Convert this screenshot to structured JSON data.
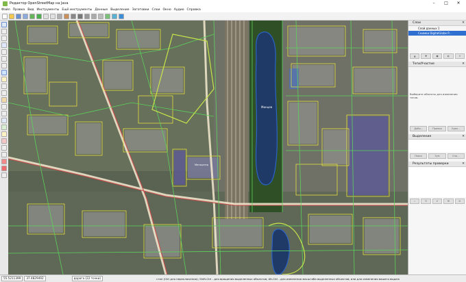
{
  "window": {
    "title": "Редактор OpenStreetMap на Java"
  },
  "menu": [
    "Файл",
    "Правка",
    "Вид",
    "Инструменты",
    "Ещё инструменты",
    "Данные",
    "Выделение",
    "Заготовки",
    "Слои",
    "Окно",
    "Аудио",
    "Справка"
  ],
  "layers_panel": {
    "title": "Слои",
    "items": [
      "Слой данных 1",
      "Снимки DigitalGlobe P..."
    ]
  },
  "tags_panel": {
    "title": "Теги/Участие",
    "hint": "Выберите объекты для изменения тегов.",
    "buttons": [
      "Доба...",
      "Правка",
      "Удал..."
    ]
  },
  "selection_panel": {
    "title": "Выделение",
    "buttons": [
      "Поиск",
      "Зум",
      "Спр..."
    ]
  },
  "validation_panel": {
    "title": "Результаты проверки"
  },
  "map_labels": {
    "lake": "Минцев",
    "mall": "Мегацентр"
  },
  "status": {
    "lat": "55.5211399",
    "lon": "37.4829492",
    "way": "дорога (22 точки)",
    "hint": "стан (Ctrl для переключения); Shift-Ctrl - для вращения выделенных объектов; Alt-Ctrl - для изменения масштаба выделенных объектов; или для изменения вашего выделения."
  }
}
